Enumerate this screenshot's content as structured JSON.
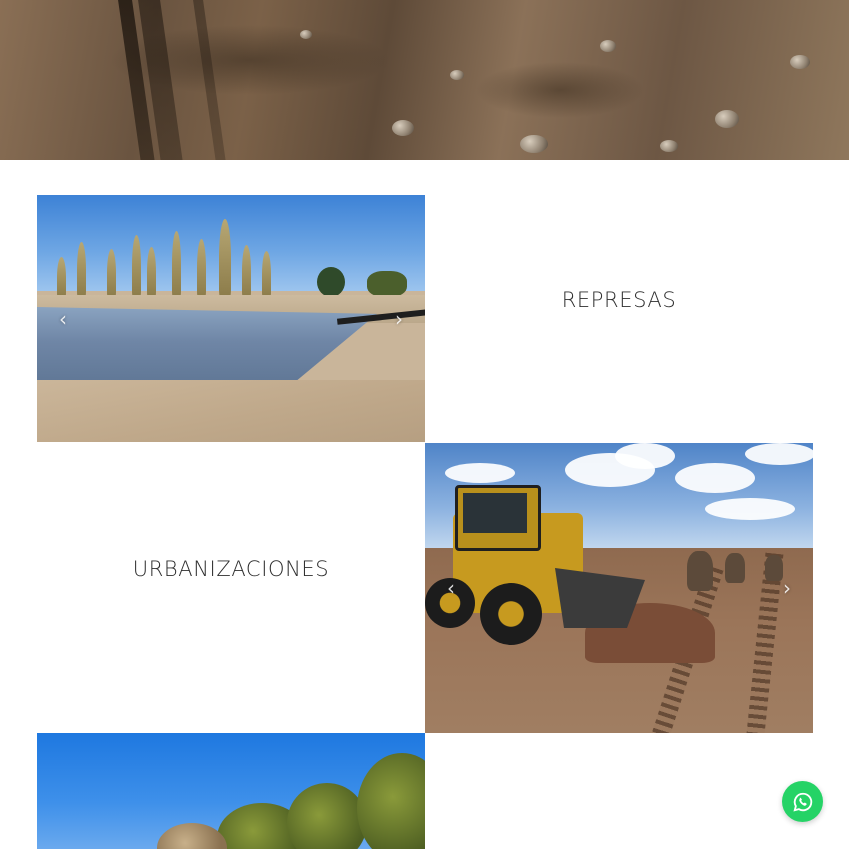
{
  "services": {
    "represas": {
      "title": "REPRESAS",
      "prev_icon": "chevron-left-icon",
      "next_icon": "chevron-right-icon"
    },
    "urbanizaciones": {
      "title": "URBANIZACIONES",
      "prev_icon": "chevron-left-icon",
      "next_icon": "chevron-right-icon"
    }
  },
  "slider_arrows": {
    "prev": "‹",
    "next": "›"
  },
  "whatsapp": {
    "icon": "whatsapp-icon",
    "color": "#25d366"
  },
  "colors": {
    "label_text": "#2e2e2e",
    "background": "#ffffff"
  }
}
